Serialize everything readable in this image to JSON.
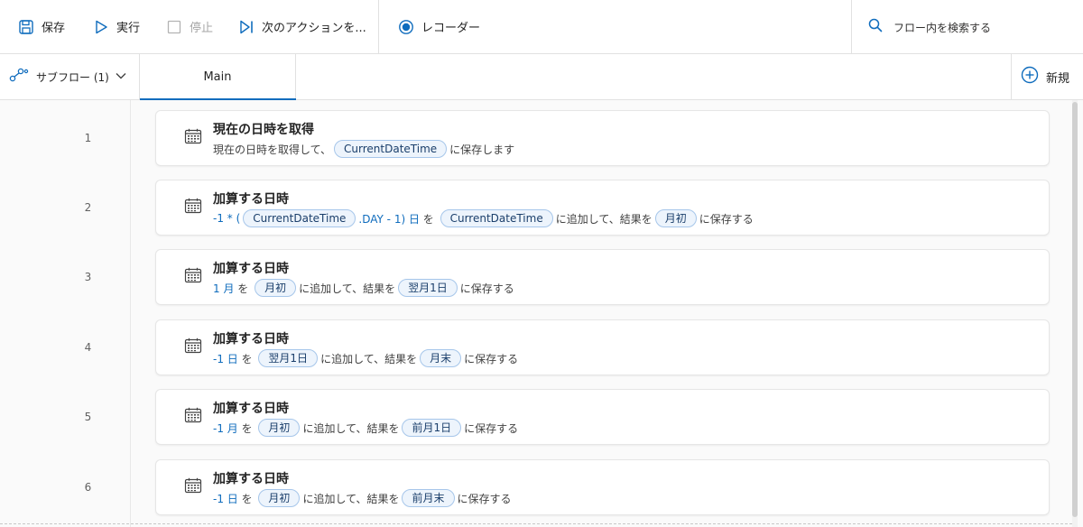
{
  "toolbar": {
    "save_label": "保存",
    "run_label": "実行",
    "stop_label": "停止",
    "next_label": "次のアクションを...",
    "recorder_label": "レコーダー",
    "search_placeholder": "フロー内を検索する"
  },
  "tabs": {
    "subflow_label": "サブフロー (1)",
    "main_label": "Main",
    "new_label": "新規"
  },
  "actions": [
    {
      "line": "1",
      "title": "現在の日時を取得",
      "segments": [
        {
          "t": "text",
          "v": "現在の日時を取得して、"
        },
        {
          "t": "pill",
          "v": "CurrentDateTime"
        },
        {
          "t": "text",
          "v": "に保存します"
        }
      ]
    },
    {
      "line": "2",
      "title": "加算する日時",
      "segments": [
        {
          "t": "num",
          "v": "-1 * ("
        },
        {
          "t": "pill",
          "v": "CurrentDateTime"
        },
        {
          "t": "num",
          "v": ".DAY - 1) 日"
        },
        {
          "t": "text",
          "v": " を "
        },
        {
          "t": "pill",
          "v": "CurrentDateTime"
        },
        {
          "t": "text",
          "v": "に追加して、結果を"
        },
        {
          "t": "pill",
          "v": "月初"
        },
        {
          "t": "text",
          "v": "に保存する"
        }
      ]
    },
    {
      "line": "3",
      "title": "加算する日時",
      "segments": [
        {
          "t": "num",
          "v": "1 月"
        },
        {
          "t": "text",
          "v": " を "
        },
        {
          "t": "pill",
          "v": "月初"
        },
        {
          "t": "text",
          "v": "に追加して、結果を"
        },
        {
          "t": "pill",
          "v": "翌月1日"
        },
        {
          "t": "text",
          "v": "に保存する"
        }
      ]
    },
    {
      "line": "4",
      "title": "加算する日時",
      "segments": [
        {
          "t": "num",
          "v": "-1 日"
        },
        {
          "t": "text",
          "v": " を "
        },
        {
          "t": "pill",
          "v": "翌月1日"
        },
        {
          "t": "text",
          "v": "に追加して、結果を"
        },
        {
          "t": "pill",
          "v": "月末"
        },
        {
          "t": "text",
          "v": "に保存する"
        }
      ]
    },
    {
      "line": "5",
      "title": "加算する日時",
      "segments": [
        {
          "t": "num",
          "v": "-1 月"
        },
        {
          "t": "text",
          "v": " を "
        },
        {
          "t": "pill",
          "v": "月初"
        },
        {
          "t": "text",
          "v": "に追加して、結果を"
        },
        {
          "t": "pill",
          "v": "前月1日"
        },
        {
          "t": "text",
          "v": "に保存する"
        }
      ]
    },
    {
      "line": "6",
      "title": "加算する日時",
      "segments": [
        {
          "t": "num",
          "v": "-1 日"
        },
        {
          "t": "text",
          "v": " を "
        },
        {
          "t": "pill",
          "v": "月初"
        },
        {
          "t": "text",
          "v": "に追加して、結果を"
        },
        {
          "t": "pill",
          "v": "前月末"
        },
        {
          "t": "text",
          "v": "に保存する"
        }
      ]
    }
  ],
  "colors": {
    "accent": "#0f6cbd",
    "pill_bg": "#edf4fc",
    "pill_border": "#a6c6ea"
  }
}
